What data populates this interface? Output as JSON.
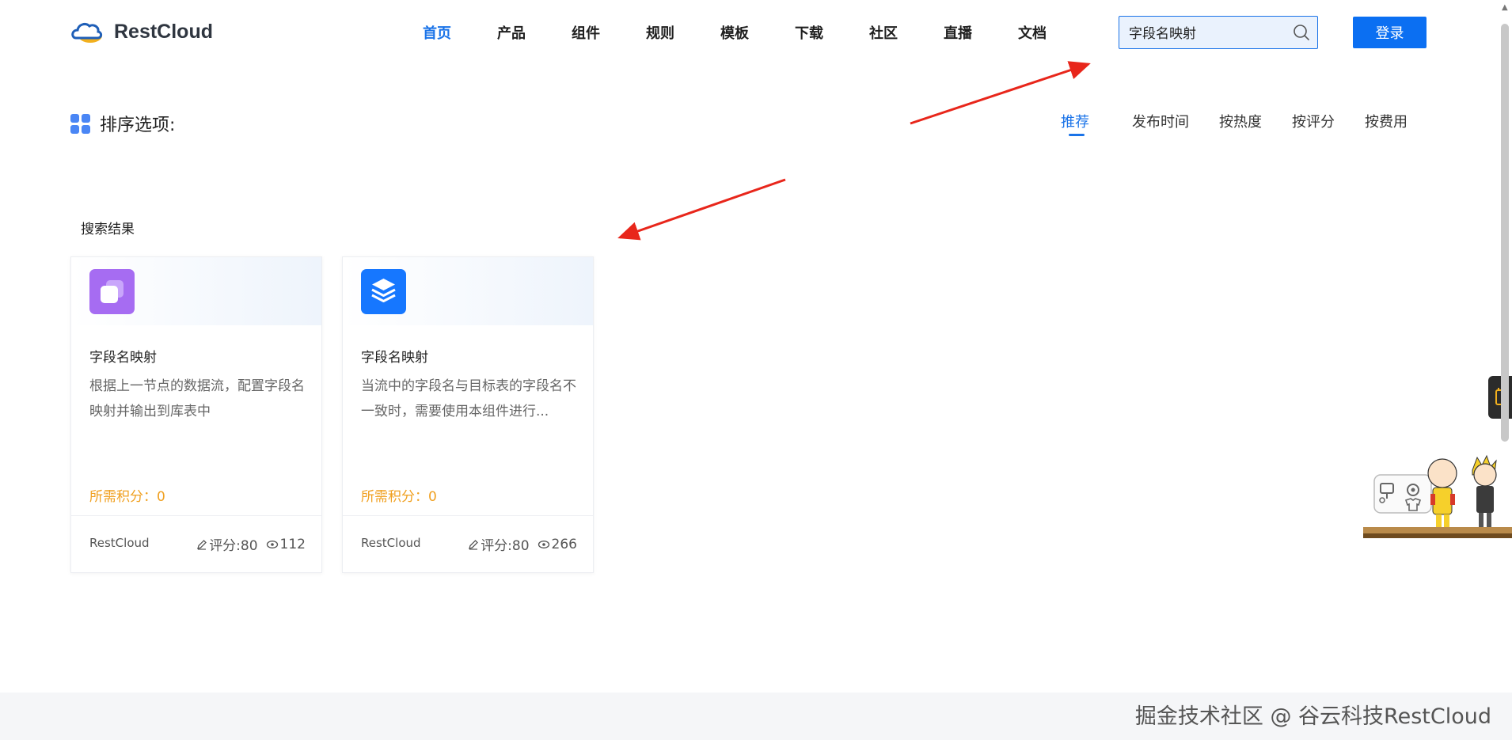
{
  "header": {
    "logo_text": "RestCloud",
    "nav": [
      "首页",
      "产品",
      "组件",
      "规则",
      "模板",
      "下载",
      "社区",
      "直播",
      "文档"
    ],
    "search_value": "字段名映射",
    "login_label": "登录"
  },
  "sort": {
    "title": "排序选项:",
    "tabs": [
      "推荐",
      "发布时间",
      "按热度",
      "按评分",
      "按费用"
    ],
    "active_tab": "推荐"
  },
  "results": {
    "label": "搜索结果",
    "cards": [
      {
        "title": "字段名映射",
        "description": "根据上一节点的数据流，配置字段名映射并输出到库表中",
        "points": "所需积分：0",
        "author": "RestCloud",
        "rating": "评分:80",
        "views": "112",
        "icon_color": "#a66cf2"
      },
      {
        "title": "字段名映射",
        "description": "当流中的字段名与目标表的字段名不一致时，需要使用本组件进行...",
        "points": "所需积分：0",
        "author": "RestCloud",
        "rating": "评分:80",
        "views": "266",
        "icon_color": "#1677ff"
      }
    ]
  },
  "footer": {
    "watermark": "掘金技术社区 @ 谷云科技RestCloud"
  },
  "colors": {
    "accent": "#1a73e8",
    "login_button": "#0b6ff2",
    "points": "#f0a020",
    "annotation_arrow": "#e8261b"
  },
  "icons": [
    "cloud-logo-icon",
    "search-icon",
    "grid-icon",
    "layers-icon",
    "edit-icon",
    "eye-icon"
  ]
}
